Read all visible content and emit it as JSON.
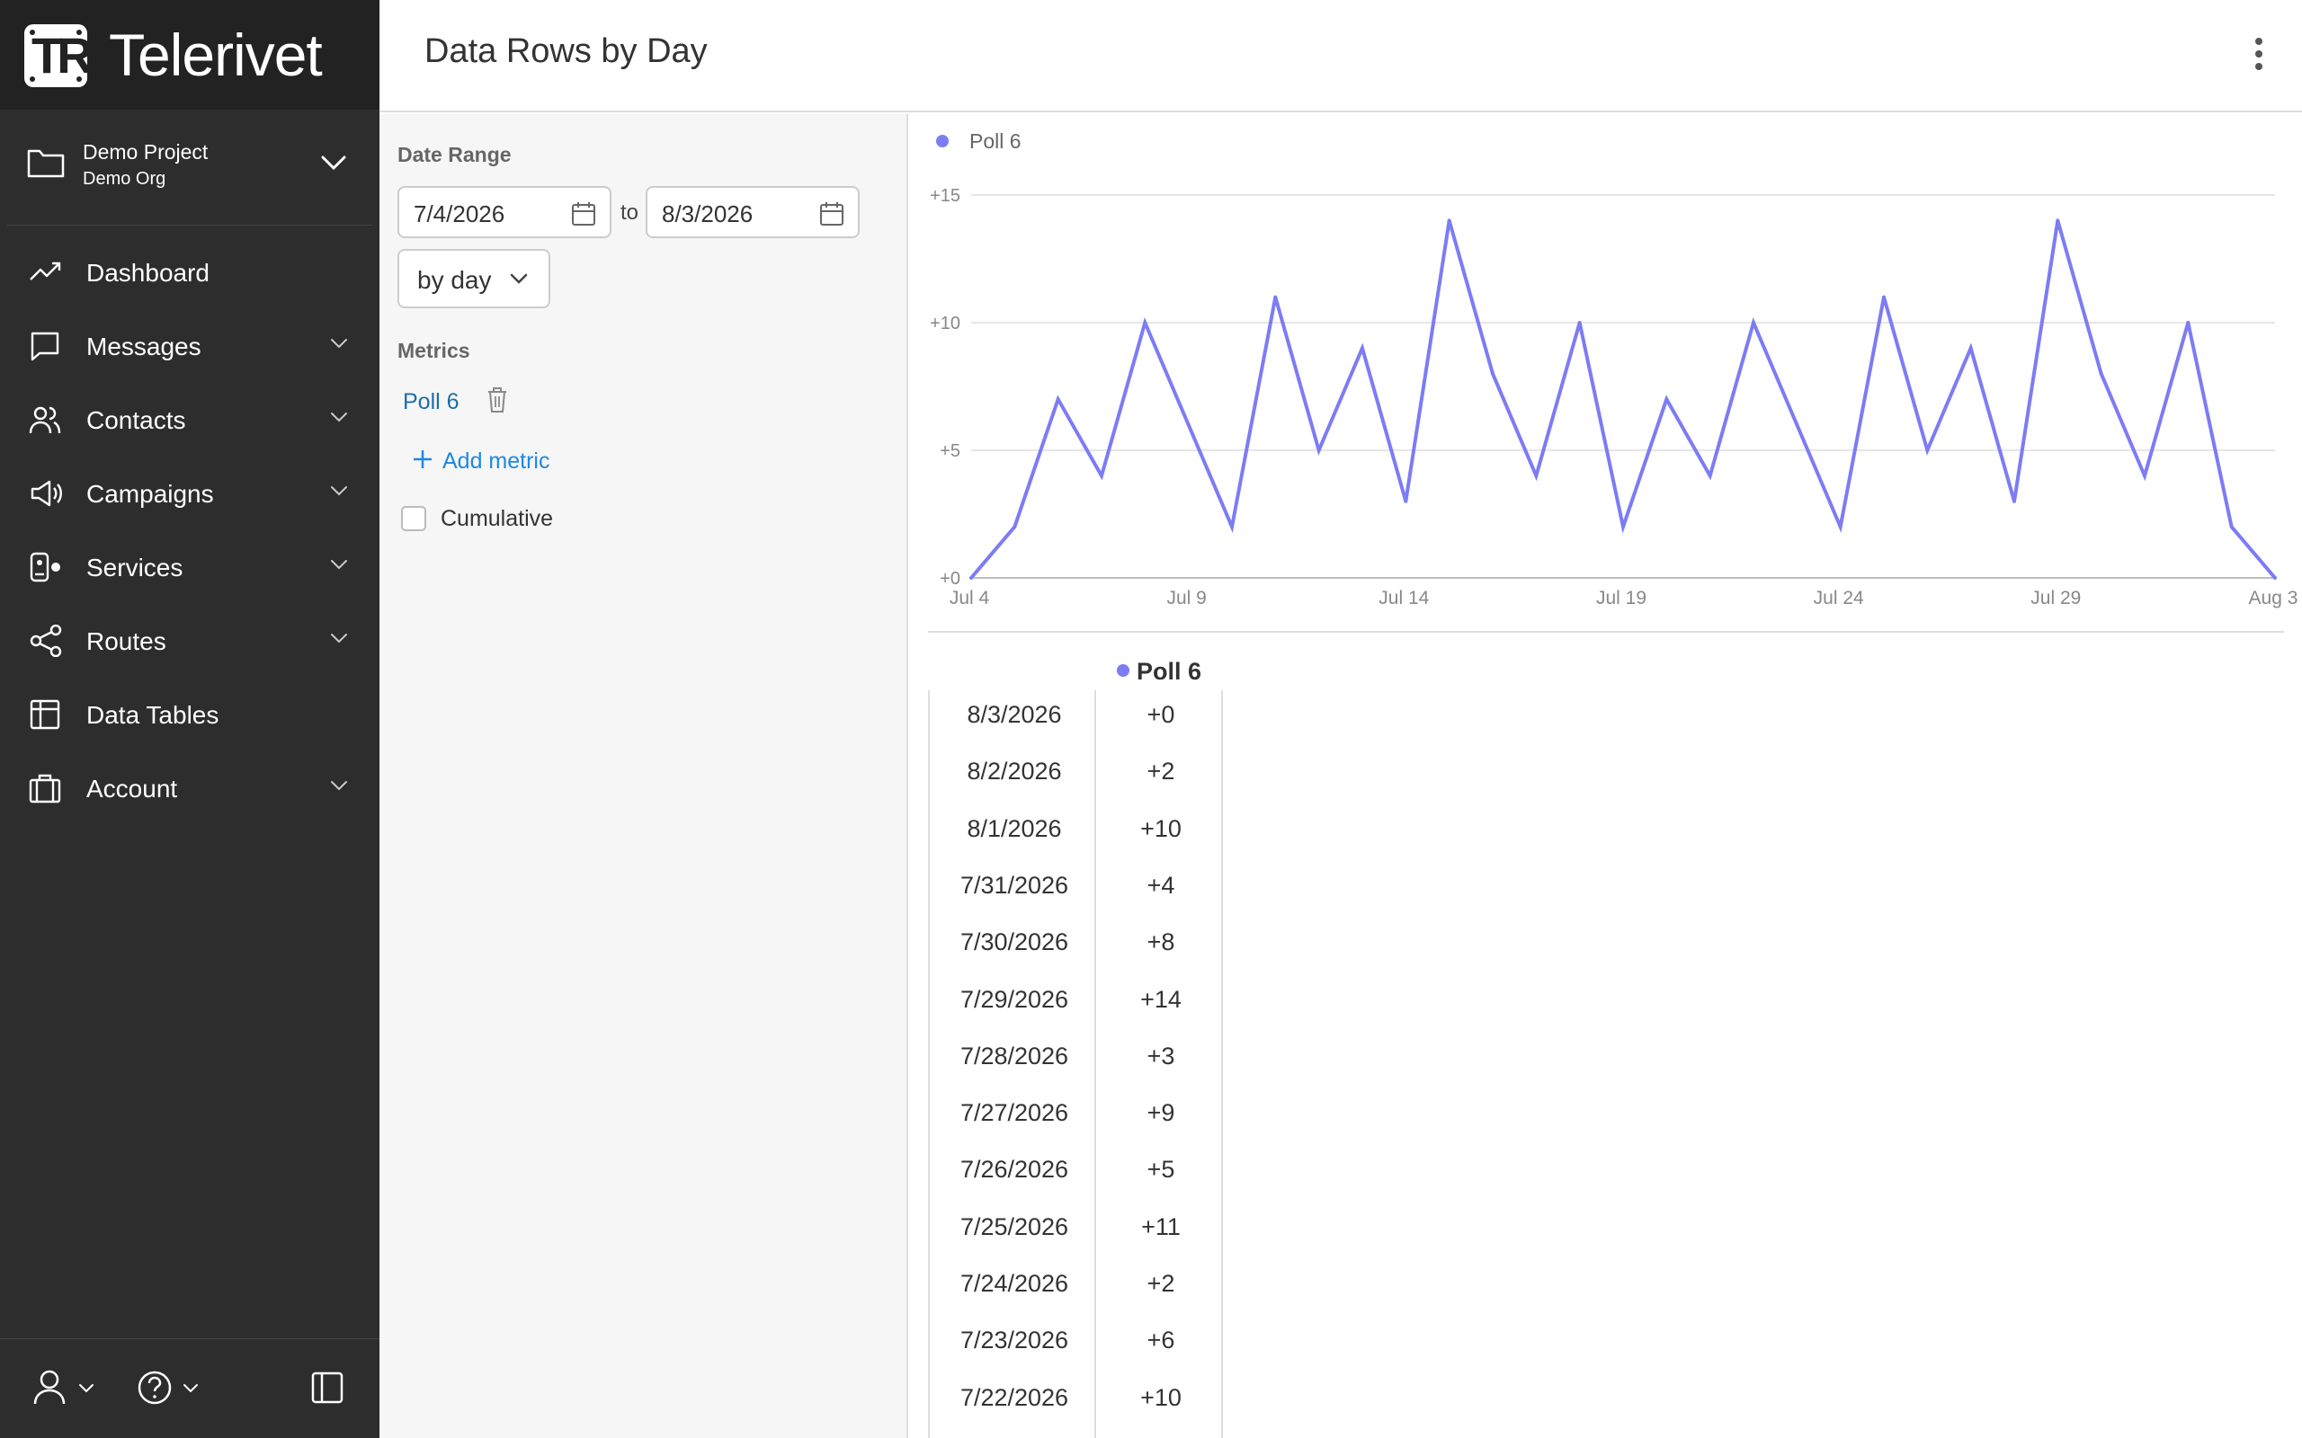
{
  "app": {
    "name": "Telerivet",
    "logo_text": "TR"
  },
  "project": {
    "name": "Demo Project",
    "org": "Demo Org"
  },
  "nav": [
    {
      "label": "Dashboard",
      "icon": "trending-up-icon",
      "has_chevron": false
    },
    {
      "label": "Messages",
      "icon": "message-icon",
      "has_chevron": true
    },
    {
      "label": "Contacts",
      "icon": "users-icon",
      "has_chevron": true
    },
    {
      "label": "Campaigns",
      "icon": "megaphone-icon",
      "has_chevron": true
    },
    {
      "label": "Services",
      "icon": "services-icon",
      "has_chevron": true
    },
    {
      "label": "Routes",
      "icon": "share-icon",
      "has_chevron": true
    },
    {
      "label": "Data Tables",
      "icon": "table-icon",
      "has_chevron": false
    },
    {
      "label": "Account",
      "icon": "briefcase-icon",
      "has_chevron": true
    }
  ],
  "header": {
    "title": "Data Rows by Day"
  },
  "filters": {
    "date_range_label": "Date Range",
    "start_date": "7/4/2026",
    "to_label": "to",
    "end_date": "8/3/2026",
    "interval": "by day",
    "metrics_label": "Metrics",
    "metric_name": "Poll 6",
    "add_metric_label": "Add metric",
    "cumulative_label": "Cumulative",
    "cumulative_checked": false
  },
  "colors": {
    "series": "#7c7cf5",
    "link": "#1e88e5",
    "sidebar_bg": "#2d2d2d"
  },
  "chart_data": {
    "type": "line",
    "legend_position": "top-left",
    "grid": true,
    "ylim": [
      0,
      15
    ],
    "y_ticks": [
      "+0",
      "+5",
      "+10",
      "+15"
    ],
    "x_ticks": [
      "Jul 4",
      "Jul 9",
      "Jul 14",
      "Jul 19",
      "Jul 24",
      "Jul 29",
      "Aug 3"
    ],
    "x": [
      "7/4/2026",
      "7/5/2026",
      "7/6/2026",
      "7/7/2026",
      "7/8/2026",
      "7/9/2026",
      "7/10/2026",
      "7/11/2026",
      "7/12/2026",
      "7/13/2026",
      "7/14/2026",
      "7/15/2026",
      "7/16/2026",
      "7/17/2026",
      "7/18/2026",
      "7/19/2026",
      "7/20/2026",
      "7/21/2026",
      "7/22/2026",
      "7/23/2026",
      "7/24/2026",
      "7/25/2026",
      "7/26/2026",
      "7/27/2026",
      "7/28/2026",
      "7/29/2026",
      "7/30/2026",
      "7/31/2026",
      "8/1/2026",
      "8/2/2026",
      "8/3/2026"
    ],
    "series": [
      {
        "name": "Poll 6",
        "values": [
          0,
          2,
          7,
          4,
          10,
          6,
          2,
          11,
          5,
          9,
          3,
          14,
          8,
          4,
          10,
          2,
          7,
          4,
          10,
          6,
          2,
          11,
          5,
          9,
          3,
          14,
          8,
          4,
          10,
          2,
          0
        ]
      }
    ]
  },
  "table": {
    "header": "Poll 6",
    "rows": [
      {
        "date": "8/3/2026",
        "value": "+0"
      },
      {
        "date": "8/2/2026",
        "value": "+2"
      },
      {
        "date": "8/1/2026",
        "value": "+10"
      },
      {
        "date": "7/31/2026",
        "value": "+4"
      },
      {
        "date": "7/30/2026",
        "value": "+8"
      },
      {
        "date": "7/29/2026",
        "value": "+14"
      },
      {
        "date": "7/28/2026",
        "value": "+3"
      },
      {
        "date": "7/27/2026",
        "value": "+9"
      },
      {
        "date": "7/26/2026",
        "value": "+5"
      },
      {
        "date": "7/25/2026",
        "value": "+11"
      },
      {
        "date": "7/24/2026",
        "value": "+2"
      },
      {
        "date": "7/23/2026",
        "value": "+6"
      },
      {
        "date": "7/22/2026",
        "value": "+10"
      }
    ]
  }
}
